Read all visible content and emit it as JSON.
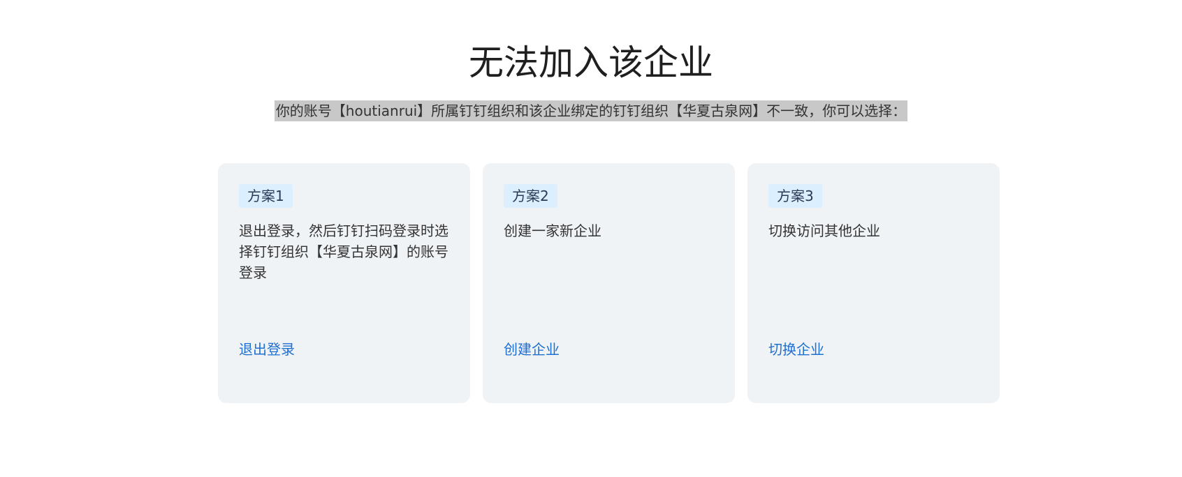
{
  "title": "无法加入该企业",
  "subtitle": "你的账号【houtianrui】所属钉钉组织和该企业绑定的钉钉组织【华夏古泉网】不一致，你可以选择：",
  "options": [
    {
      "tag": "方案1",
      "description": "退出登录，然后钉钉扫码登录时选择钉钉组织【华夏古泉网】的账号登录",
      "action": "退出登录"
    },
    {
      "tag": "方案2",
      "description": "创建一家新企业",
      "action": "创建企业"
    },
    {
      "tag": "方案3",
      "description": "切换访问其他企业",
      "action": "切换企业"
    }
  ],
  "colors": {
    "card_bg": "#f0f3f6",
    "tag_bg": "#dbefff",
    "link": "#1f6fd1",
    "highlight": "#c8c8c8"
  }
}
